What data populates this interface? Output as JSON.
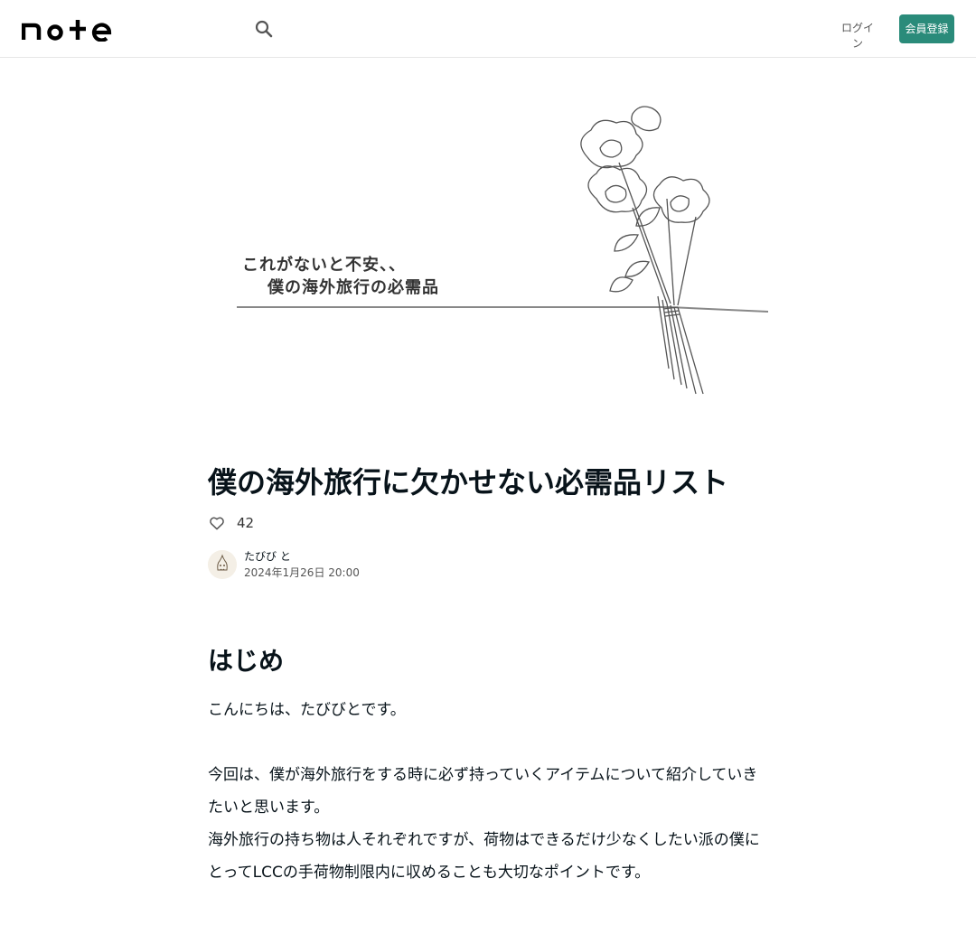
{
  "header": {
    "logo_text": "note",
    "login_label": "ログイン",
    "signup_label": "会員登録"
  },
  "hero": {
    "caption_line1": "これがないと不安、、",
    "caption_line2": "僕の海外旅行の必需品"
  },
  "article": {
    "title": "僕の海外旅行に欠かせない必需品リスト",
    "like_count": "42",
    "author_name": "たびび と",
    "published": "2024年1月26日 20:00",
    "section_heading": "はじめ",
    "paragraphs": [
      "こんにちは、たびびとです。",
      "今回は、僕が海外旅行をする時に必ず持っていくアイテムについて紹介していきたいと思います。",
      "海外旅行の持ち物は人それぞれですが、荷物はできるだけ少なくしたい派の僕にとってLCCの手荷物制限内に収めることも大切なポイントです。"
    ]
  },
  "colors": {
    "accent": "#2a8b7a",
    "text": "#08131a"
  }
}
